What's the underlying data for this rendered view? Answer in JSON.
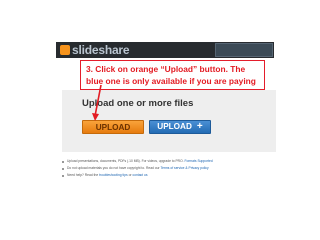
{
  "header": {
    "logo_text": "slideshare",
    "colors": {
      "background": "#272b2f",
      "logo_icon": "#f7941d"
    }
  },
  "callout": {
    "line1": "3. Click on orange “Upload” button. The",
    "line2": "blue one is only available if you are paying",
    "color": "#e31b23"
  },
  "panel": {
    "title": "Upload one or more files",
    "upload_orange_label": "UPLOAD",
    "upload_blue_label": "UPLOAD",
    "upload_blue_plus": "+"
  },
  "info": {
    "line1_text": "Upload presentations, documents, PDFs (.10 MB). For videos, upgrade to PRO.",
    "line1_link": "Formats Supported",
    "line2_text": "Do not upload materials you do not have copyright to. Read our",
    "line2_link": "Terms of service & Privacy policy",
    "line3_text": "Need help? Read the",
    "line3_link": "troubleshooting tips",
    "line3_or": "or",
    "line3_link2": "contact us"
  }
}
